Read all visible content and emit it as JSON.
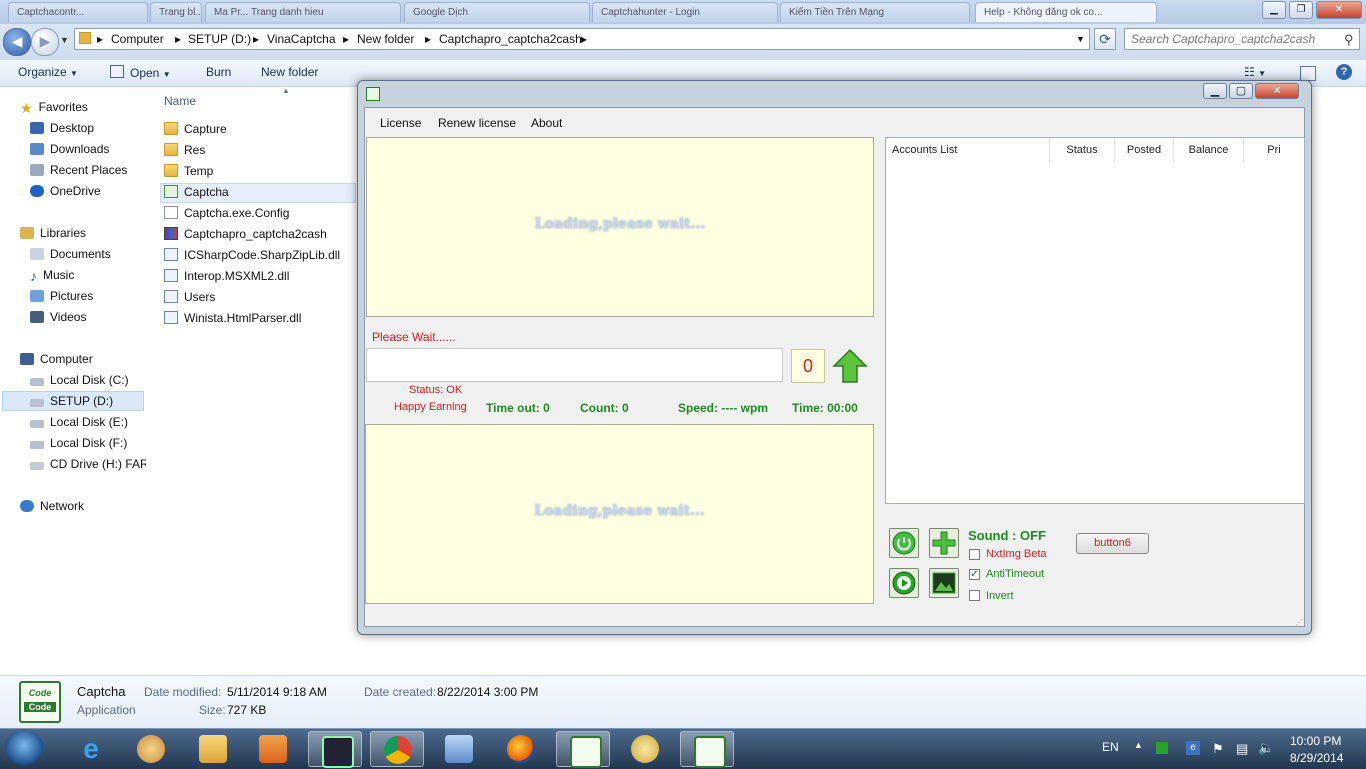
{
  "browser": {
    "tabs": [
      "Captchacontr...",
      "Trang bl...",
      "Ma Pr... Trang danh hieu",
      "Google Dịch",
      "Captchahunter - Login",
      "Kiếm Tiền Trên Mạng",
      "Help - Không đăng ok co..."
    ]
  },
  "explorer": {
    "breadcrumbs": [
      "Computer",
      "SETUP (D:)",
      "VinaCaptcha",
      "New folder",
      "Captchapro_captcha2cash"
    ],
    "search_placeholder": "Search Captchapro_captcha2cash",
    "toolbar": {
      "organize": "Organize",
      "open": "Open",
      "burn": "Burn",
      "new_folder": "New folder"
    },
    "nav": {
      "favorites": "Favorites",
      "favorites_items": [
        "Desktop",
        "Downloads",
        "Recent Places",
        "OneDrive"
      ],
      "libraries": "Libraries",
      "libraries_items": [
        "Documents",
        "Music",
        "Pictures",
        "Videos"
      ],
      "computer": "Computer",
      "computer_items": [
        "Local Disk (C:)",
        "SETUP (D:)",
        "Local Disk (E:)",
        "Local Disk (F:)",
        "CD Drive (H:) FAR"
      ],
      "network": "Network"
    },
    "columns": {
      "name": "Name"
    },
    "files": [
      {
        "name": "Capture",
        "type": "folder"
      },
      {
        "name": "Res",
        "type": "folder"
      },
      {
        "name": "Temp",
        "type": "folder"
      },
      {
        "name": "Captcha",
        "type": "app"
      },
      {
        "name": "Captcha.exe.Config",
        "type": "doc"
      },
      {
        "name": "Captchapro_captcha2cash",
        "type": "rar"
      },
      {
        "name": "ICSharpCode.SharpZipLib.dll",
        "type": "dll"
      },
      {
        "name": "Interop.MSXML2.dll",
        "type": "dll"
      },
      {
        "name": "Users",
        "type": "dll"
      },
      {
        "name": "Winista.HtmlParser.dll",
        "type": "dll"
      }
    ],
    "details": {
      "name": "Captcha",
      "kind": "Application",
      "modified_label": "Date modified:",
      "modified_value": "5/11/2014 9:18 AM",
      "created_label": "Date created:",
      "created_value": "8/22/2014 3:00 PM",
      "size_label": "Size:",
      "size_value": "727 KB",
      "icon_text_top": "Code",
      "icon_text_bottom": "Code"
    }
  },
  "app": {
    "menu": [
      "License",
      "Renew license",
      "About"
    ],
    "loading_text": "Loading,please wait...",
    "please_wait": "Please Wait......",
    "counter": "0",
    "status": "Status: OK",
    "happy": "Happy Earning",
    "timeout": "Time out: 0",
    "count": "Count: 0",
    "speed": "Speed: ---- wpm",
    "time": "Time: 00:00",
    "accounts_columns": [
      "Accounts List",
      "Status",
      "Posted",
      "Balance",
      "Pri"
    ],
    "sound": "Sound : OFF",
    "button6": "button6",
    "checkboxes": [
      {
        "label": "NxtImg Beta",
        "checked": false,
        "color": "#d12020"
      },
      {
        "label": "AntiTimeout",
        "checked": true,
        "color": "#1f8a1f"
      },
      {
        "label": "Invert",
        "checked": false,
        "color": "#1f8a1f"
      }
    ]
  },
  "taskbar": {
    "lang": "EN",
    "time": "10:00 PM",
    "date": "8/29/2014"
  }
}
